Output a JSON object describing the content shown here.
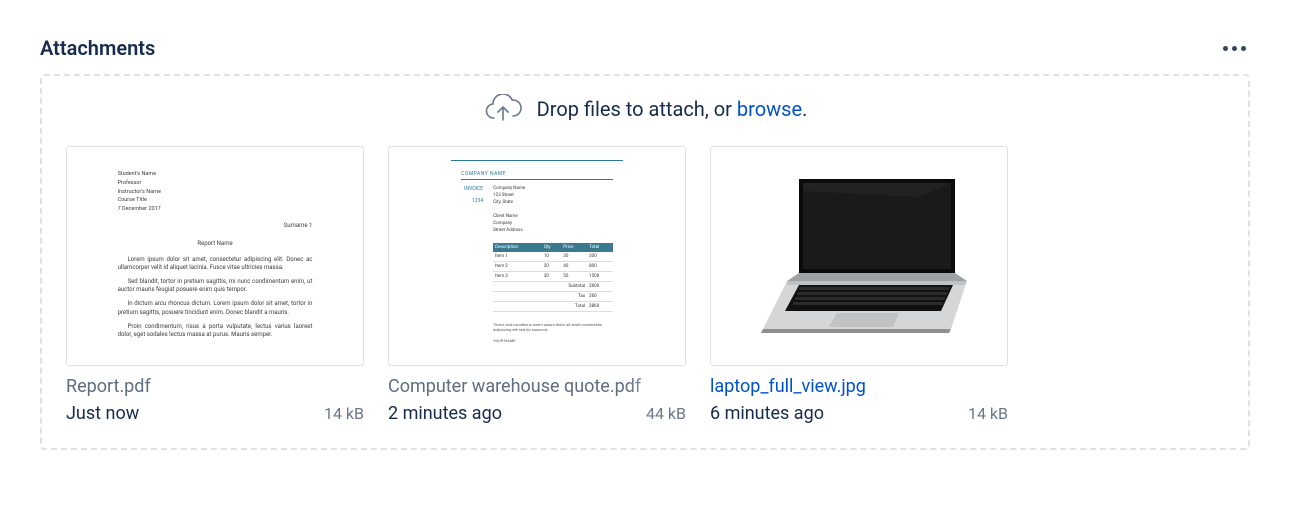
{
  "section": {
    "title": "Attachments"
  },
  "dropzone": {
    "text_prefix": "Drop files to attach, or ",
    "browse_label": "browse",
    "text_suffix": "."
  },
  "attachments": [
    {
      "name": "Report.pdf",
      "time": "Just now",
      "size": "14 kB",
      "is_link": false,
      "kind": "doc"
    },
    {
      "name": "Computer warehouse quote.pdf",
      "time": "2 minutes ago",
      "size": "44 kB",
      "is_link": false,
      "kind": "invoice"
    },
    {
      "name": "laptop_full_view.jpg",
      "time": "6 minutes ago",
      "size": "14 kB",
      "is_link": true,
      "kind": "laptop"
    }
  ]
}
